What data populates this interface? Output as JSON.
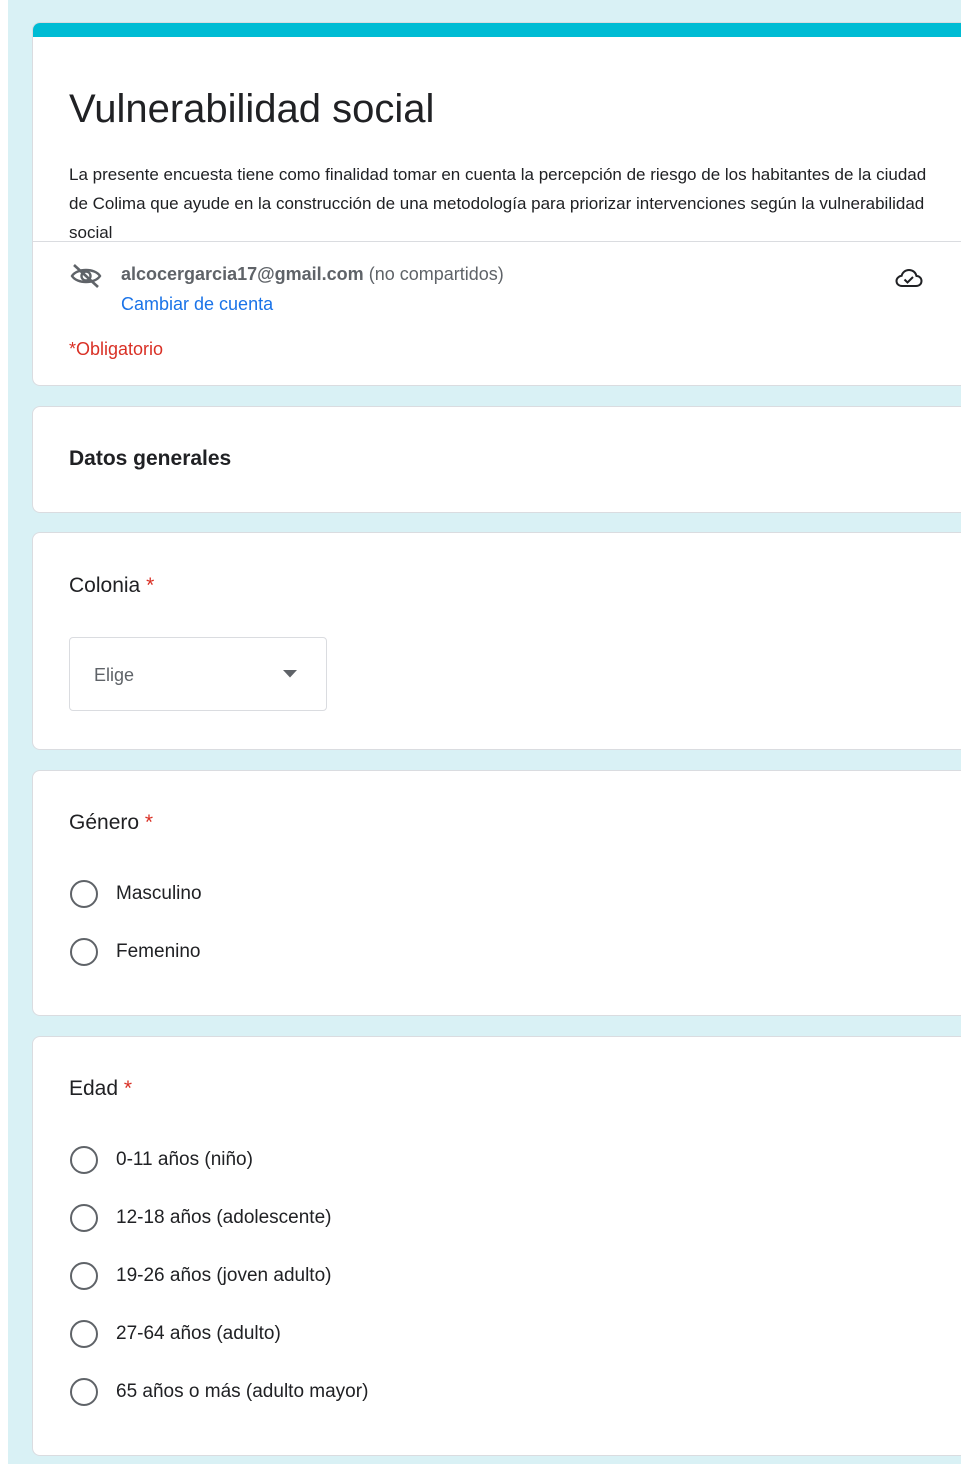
{
  "form": {
    "title": "Vulnerabilidad social",
    "description": "La presente encuesta tiene como finalidad tomar en cuenta la percepción de riesgo de los habitantes de la ciudad de Colima que ayude en la construcción de una metodología para priorizar intervenciones según la vulnerabilidad social",
    "accent_color": "#00bcd4",
    "background_color": "#d9f1f5",
    "account": {
      "email": "alcocergarcia17@gmail.com",
      "note": "(no compartidos)",
      "switch_label": "Cambiar de cuenta",
      "privacy_icon": "eye-off-icon",
      "save_icon": "cloud-check-icon"
    },
    "required_note": "*Obligatorio"
  },
  "section": {
    "title": "Datos generales"
  },
  "questions": {
    "colonia": {
      "title": "Colonia",
      "required_mark": "*",
      "dropdown_placeholder": "Elige"
    },
    "genero": {
      "title": "Género",
      "required_mark": "*",
      "options": [
        "Masculino",
        "Femenino"
      ]
    },
    "edad": {
      "title": "Edad",
      "required_mark": "*",
      "options": [
        "0-11 años (niño)",
        "12-18 años (adolescente)",
        "19-26 años (joven adulto)",
        "27-64 años (adulto)",
        "65 años o más (adulto mayor)"
      ]
    }
  }
}
